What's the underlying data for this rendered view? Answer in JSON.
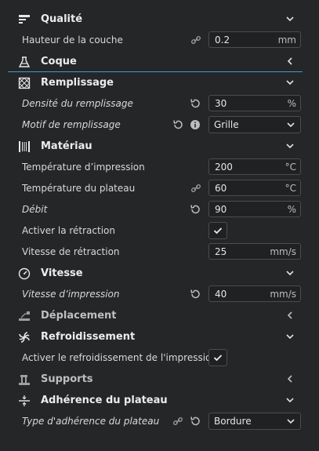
{
  "sections": {
    "quality": "Qualité",
    "shell": "Coque",
    "infill": "Remplissage",
    "material": "Matériau",
    "speed": "Vitesse",
    "travel": "Déplacement",
    "cooling": "Refroidissement",
    "supports": "Supports",
    "adhesion": "Adhérence du plateau"
  },
  "rows": {
    "layer_height": {
      "label": "Hauteur de la couche",
      "value": "0.2",
      "unit": "mm"
    },
    "infill_density": {
      "label": "Densité du remplissage",
      "value": "30",
      "unit": "%"
    },
    "infill_pattern": {
      "label": "Motif de remplissage",
      "value": "Grille"
    },
    "print_temp": {
      "label": "Température d’impression",
      "value": "200",
      "unit": "°C"
    },
    "bed_temp": {
      "label": "Température du plateau",
      "value": "60",
      "unit": "°C"
    },
    "flow": {
      "label": "Débit",
      "value": "90",
      "unit": "%"
    },
    "retraction_enable": {
      "label": "Activer la rétraction",
      "checked": true
    },
    "retraction_speed": {
      "label": "Vitesse de rétraction",
      "value": "25",
      "unit": "mm/s"
    },
    "print_speed": {
      "label": "Vitesse d’impression",
      "value": "40",
      "unit": "mm/s"
    },
    "cooling_enable": {
      "label": "Activer le refroidissement de l'impression",
      "checked": true
    },
    "adhesion_type": {
      "label": "Type d'adhérence du plateau",
      "value": "Bordure"
    }
  },
  "colors": {
    "background": "#252628",
    "accent": "#3a9bd8",
    "field_border": "#4a4c50"
  },
  "icons": [
    "quality-icon",
    "shell-icon",
    "infill-icon",
    "material-icon",
    "speed-icon",
    "travel-icon",
    "cooling-icon",
    "supports-icon",
    "adhesion-icon",
    "link-icon",
    "reset-icon",
    "info-icon",
    "chevron-down-icon",
    "chevron-left-icon",
    "check-icon"
  ]
}
